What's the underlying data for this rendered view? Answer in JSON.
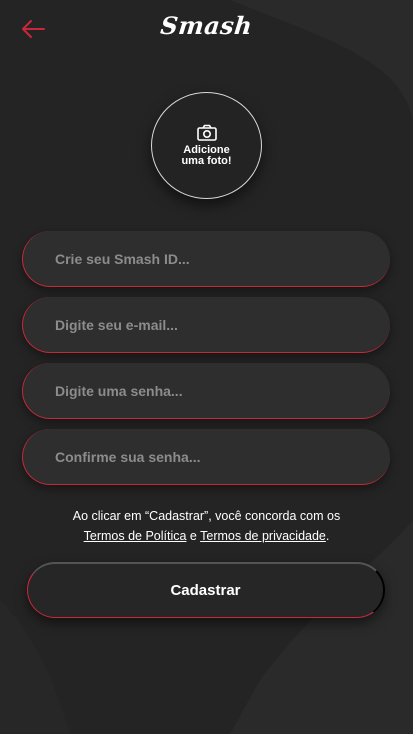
{
  "header": {
    "back_icon": "arrow-left-icon",
    "logo_text": "Smash"
  },
  "photo": {
    "icon": "camera-icon",
    "label": "Adicione uma foto!"
  },
  "form": {
    "smash_id_placeholder": "Crie seu Smash ID...",
    "email_placeholder": "Digite seu e-mail...",
    "password_placeholder": "Digite uma senha...",
    "confirm_placeholder": "Confirme sua senha..."
  },
  "terms": {
    "prefix": "Ao clicar em “Cadastrar”, você concorda com os",
    "link_terms": "Termos de Política",
    "conjunction": " e ",
    "link_privacy": "Termos de privacidade",
    "suffix": "."
  },
  "submit": {
    "label": "Cadastrar"
  },
  "colors": {
    "background": "#242424",
    "accent": "#c8283a",
    "placeholder": "#8c8c8c"
  }
}
